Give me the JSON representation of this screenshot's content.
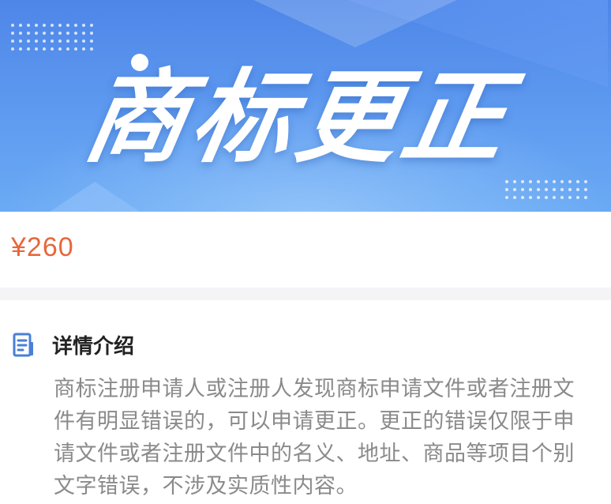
{
  "banner": {
    "title": "商标更正"
  },
  "product": {
    "price": "¥260"
  },
  "detail": {
    "heading": "详情介绍",
    "description": "商标注册申请人或注册人发现商标申请文件或者注册文件有明显错误的，可以申请更正。更正的错误仅限于申请文件或者注册文件中的名义、地址、商品等项目个别文字错误，不涉及实质性内容。"
  },
  "colors": {
    "banner_blue": "#5f9bf0",
    "price_orange": "#e8673a",
    "icon_blue": "#4a7fd6"
  },
  "icons": {
    "detail_icon": "document-icon"
  }
}
